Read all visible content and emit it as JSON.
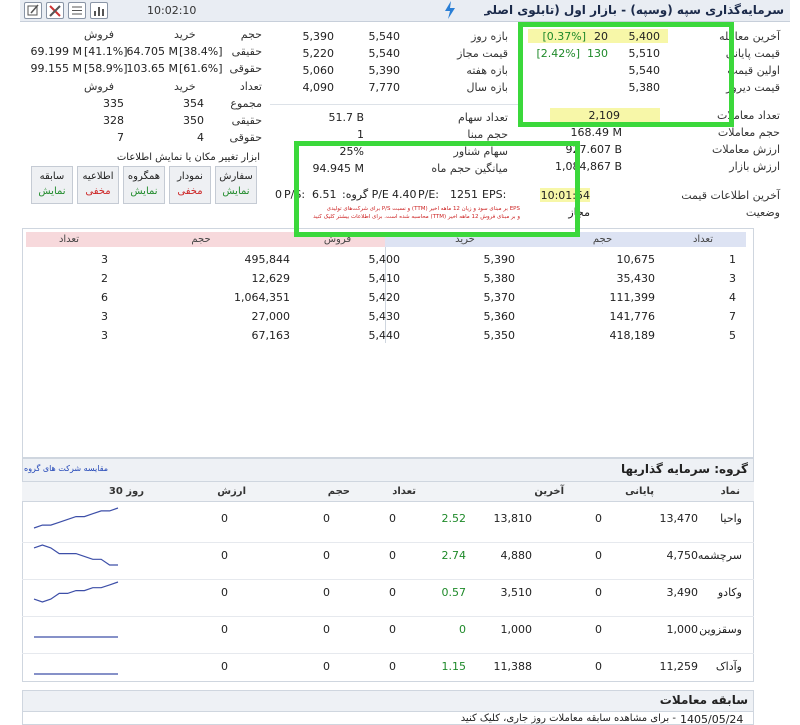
{
  "header": {
    "time": "10:02:10",
    "title": "سرمایه‌گذاری سپه (وسپه) - بازار اول (تابلوی اصلی) بورس",
    "icons": [
      "edit-icon",
      "tools-icon",
      "list-icon",
      "chart-bars-icon"
    ]
  },
  "prices": {
    "last_trade": {
      "label": "آخرین معامله",
      "value": "5,400",
      "vol": "20",
      "pct": "[0.37%]"
    },
    "closing": {
      "label": "قیمت پایانی",
      "value": "5,510",
      "vol": "130",
      "pct": "[2.42%]"
    },
    "first": {
      "label": "اولین قیمت",
      "value": "5,540"
    },
    "yesterday": {
      "label": "قیمت دیروز",
      "value": "5,380"
    },
    "count": {
      "label": "تعداد معاملات",
      "value": "2,109"
    },
    "volume": {
      "label": "حجم معاملات",
      "value": "168.49 M"
    },
    "value": {
      "label": "ارزش معاملات",
      "value": "927.607 B"
    },
    "market_value": {
      "label": "ارزش بازار",
      "value": "1,084,867 B"
    },
    "last_info": {
      "label": "آخرین اطلاعات قیمت",
      "value": "10:01:54"
    },
    "status": {
      "label": "وضعیت",
      "value": "مجاز"
    }
  },
  "ranges": {
    "day": {
      "label": "بازه روز",
      "low": "5,390",
      "high": "5,540"
    },
    "allowed": {
      "label": "قیمت مجاز",
      "low": "5,220",
      "high": "5,540"
    },
    "week": {
      "label": "بازه هفته",
      "low": "5,060",
      "high": "5,390"
    },
    "year": {
      "label": "بازه سال",
      "low": "4,090",
      "high": "7,770"
    }
  },
  "stock": {
    "shares": {
      "label": "تعداد سهام",
      "value": "51.7 B"
    },
    "base_vol": {
      "label": "حجم مبنا",
      "value": "1"
    },
    "float": {
      "label": "سهام شناور",
      "value": "25%"
    },
    "month_avg": {
      "label": "میانگین حجم ماه",
      "value": "94.945 M"
    }
  },
  "eps_line": {
    "eps_label": "EPS:",
    "eps": "1251",
    "pe_label": "P/E:",
    "pe": "4.40",
    "gpe_label": "P/E گروه:",
    "gpe": "6.51",
    "ps_label": "P/S:",
    "ps": "0",
    "note1": "EPS بر مبنای سود و زیان 12 ماهه اخیر (TTM) و نسبت P/S برای شرکت‌های تولیدی",
    "note2": "و بر مبنای فروش 12 ماهه اخیر (TTM) محاسبه شده است. برای اطلاعات بیشتر کلیک کنید"
  },
  "traders": {
    "col_buy": "خرید",
    "col_sell": "فروش",
    "volume": {
      "label": "حجم"
    },
    "real_vol": {
      "label": "حقیقی",
      "buy": "64.705 M",
      "buy_pct": "[38.4%]",
      "sell": "69.199 M",
      "sell_pct": "[41.1%]"
    },
    "legal_vol": {
      "label": "حقوقی",
      "buy": "103.65 M",
      "buy_pct": "[61.6%]",
      "sell": "99.155 M",
      "sell_pct": "[58.9%]"
    },
    "count": {
      "label": "تعداد"
    },
    "total": {
      "label": "مجموع",
      "buy": "354",
      "sell": "335"
    },
    "real_cnt": {
      "label": "حقیقی",
      "buy": "350",
      "sell": "328"
    },
    "legal_cnt": {
      "label": "حقوقی",
      "buy": "4",
      "sell": "7"
    }
  },
  "tools": {
    "title": "ابزار تغییر مکان یا نمایش اطلاعات",
    "buttons": [
      {
        "label": "سفارش",
        "state": "نمایش"
      },
      {
        "label": "نمودار",
        "state": "مخفی"
      },
      {
        "label": "همگروه",
        "state": "نمایش"
      },
      {
        "label": "اطلاعیه",
        "state": "مخفی"
      },
      {
        "label": "سابقه",
        "state": "نمایش"
      }
    ]
  },
  "orderbook": {
    "headers": {
      "buy_count": "تعداد",
      "buy_vol": "حجم",
      "buy_price": "خرید",
      "sell_price": "فروش",
      "sell_vol": "حجم",
      "sell_count": "تعداد"
    },
    "rows": [
      {
        "buy_count": "1",
        "buy_vol": "10,675",
        "buy_price": "5,390",
        "sell_price": "5,400",
        "sell_vol": "495,844",
        "sell_count": "3"
      },
      {
        "buy_count": "3",
        "buy_vol": "35,430",
        "buy_price": "5,380",
        "sell_price": "5,410",
        "sell_vol": "12,629",
        "sell_count": "2"
      },
      {
        "buy_count": "4",
        "buy_vol": "111,399",
        "buy_price": "5,370",
        "sell_price": "5,420",
        "sell_vol": "1,064,351",
        "sell_count": "6"
      },
      {
        "buy_count": "7",
        "buy_vol": "141,776",
        "buy_price": "5,360",
        "sell_price": "5,430",
        "sell_vol": "27,000",
        "sell_count": "3"
      },
      {
        "buy_count": "5",
        "buy_vol": "418,189",
        "buy_price": "5,350",
        "sell_price": "5,440",
        "sell_vol": "67,163",
        "sell_count": "3"
      }
    ]
  },
  "group": {
    "title": "گروه: سرمایه گذاریها",
    "compare_link": "مقایسه شرکت های گروه",
    "headers": {
      "symbol": "نماد",
      "close": "پایانی",
      "last": "آخرین",
      "count": "تعداد",
      "volume": "حجم",
      "value": "ارزش",
      "days30": "30 روز"
    },
    "rows": [
      {
        "symbol": "واحیا",
        "close": "13,470",
        "close_chg": "0",
        "last": "13,810",
        "last_pct": "2.52",
        "count": "0",
        "volume": "0",
        "value": "0",
        "spark": [
          3,
          4,
          4,
          5,
          6,
          7,
          7,
          8,
          9,
          9,
          10
        ]
      },
      {
        "symbol": "سرچشمه",
        "close": "4,750",
        "close_chg": "0",
        "last": "4,880",
        "last_pct": "2.74",
        "count": "0",
        "volume": "0",
        "value": "0",
        "spark": [
          9,
          10,
          9,
          7,
          7,
          7,
          6,
          5,
          5,
          3,
          3
        ]
      },
      {
        "symbol": "وکادو",
        "close": "3,490",
        "close_chg": "0",
        "last": "3,510",
        "last_pct": "0.57",
        "count": "0",
        "volume": "0",
        "value": "0",
        "spark": [
          3,
          2,
          3,
          5,
          5,
          6,
          6,
          7,
          7,
          8,
          9
        ]
      },
      {
        "symbol": "وسقزوین",
        "close": "1,000",
        "close_chg": "0",
        "last": "1,000",
        "last_pct": "0",
        "count": "0",
        "volume": "0",
        "value": "0",
        "spark": [
          5,
          5,
          5,
          5,
          5,
          5,
          5,
          5,
          5,
          5,
          5
        ]
      },
      {
        "symbol": "وآداک",
        "close": "11,259",
        "close_chg": "0",
        "last": "11,388",
        "last_pct": "1.15",
        "count": "0",
        "volume": "0",
        "value": "0",
        "spark": [
          5,
          5,
          5,
          5,
          5,
          5,
          5,
          5,
          5,
          5,
          5
        ]
      }
    ]
  },
  "history": {
    "title": "سابقه معاملات",
    "date": "1405/05/24",
    "note": "- برای مشاهده سابقه معاملات روز جاری، کلیک کنید"
  }
}
